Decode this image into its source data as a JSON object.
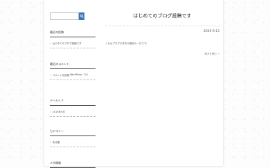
{
  "search": {
    "placeholder": "",
    "button_icon": "search-icon",
    "button_color": "#3a78b8"
  },
  "sidebar": {
    "widgets": [
      {
        "title": "最近の投稿",
        "items": [
          {
            "label": "はじめてのブログ投稿です"
          }
        ]
      },
      {
        "title": "最近のコメント",
        "items": [
          {
            "label": "コメントを投稿",
            "extra": "WordPress コメ"
          }
        ]
      },
      {
        "title": "アーカイブ",
        "items": [
          {
            "label": "2019年9月"
          }
        ]
      },
      {
        "title": "カテゴリー",
        "items": [
          {
            "label": "未分類"
          }
        ]
      },
      {
        "title": "メタ情報"
      }
    ]
  },
  "post": {
    "title": "はじめてのブログ投稿です",
    "date": "2019.9.13",
    "body": "これはブログの本文の最初の一行です。",
    "more": "続きを読む →"
  }
}
